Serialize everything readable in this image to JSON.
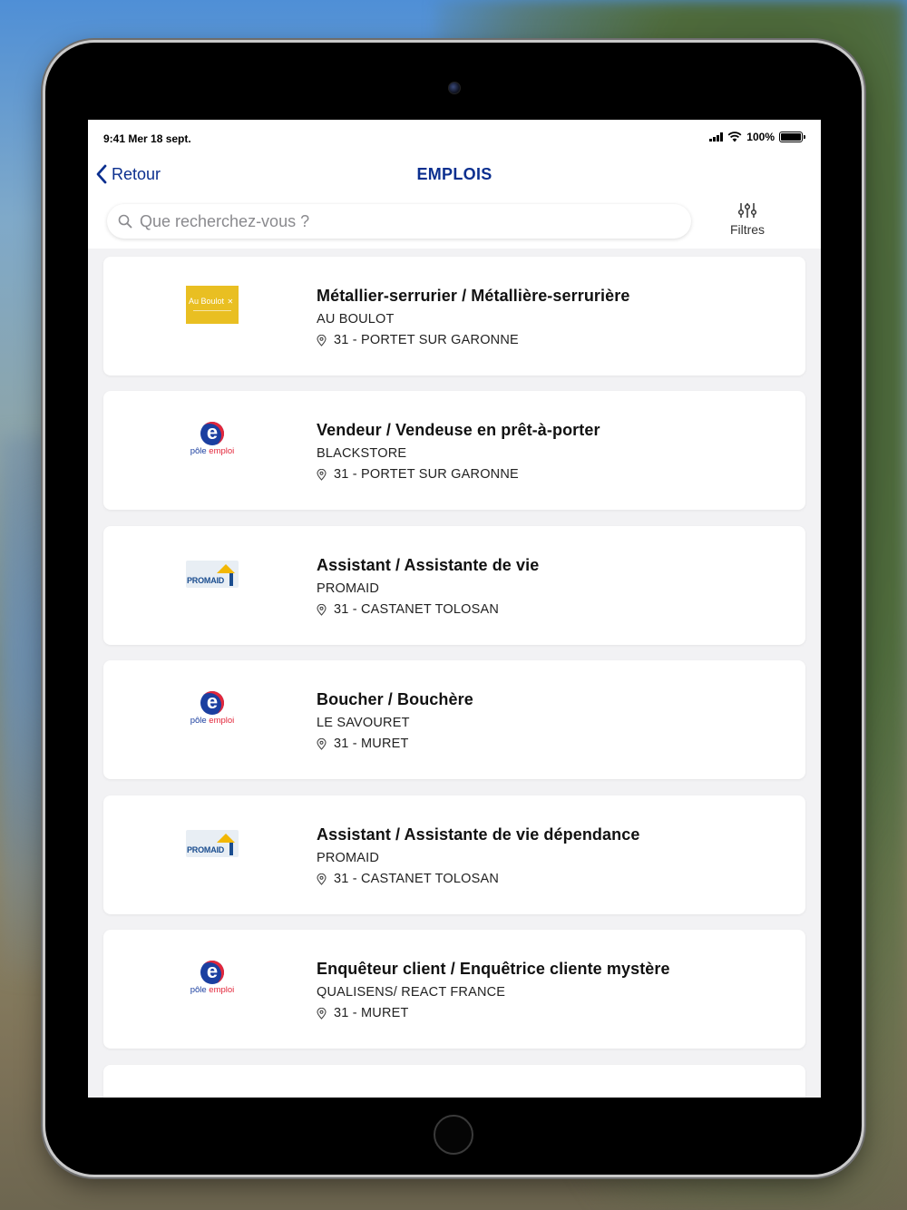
{
  "status_bar": {
    "time_date": "9:41  Mer 18 sept.",
    "battery": "100%"
  },
  "nav": {
    "back_label": "Retour",
    "title": "EMPLOIS"
  },
  "search": {
    "placeholder": "Que recherchez-vous ?",
    "value": ""
  },
  "filters": {
    "label": "Filtres"
  },
  "logo_texts": {
    "au_boulot": "Au Boulot",
    "pole_emploi_e": "e",
    "pole_emploi_a": "pôle",
    "pole_emploi_b": "emploi",
    "promaid": "PROMAID"
  },
  "jobs": [
    {
      "title": "Métallier-serrurier / Métallière-serrurière",
      "company": "AU BOULOT",
      "location": "31 - PORTET SUR GARONNE",
      "logo": "au-boulot"
    },
    {
      "title": "Vendeur / Vendeuse en prêt-à-porter",
      "company": "BLACKSTORE",
      "location": "31 - PORTET SUR GARONNE",
      "logo": "pole-emploi"
    },
    {
      "title": "Assistant / Assistante de vie",
      "company": "PROMAID",
      "location": "31 - CASTANET TOLOSAN",
      "logo": "promaid"
    },
    {
      "title": "Boucher / Bouchère",
      "company": "LE SAVOURET",
      "location": "31 - MURET",
      "logo": "pole-emploi"
    },
    {
      "title": "Assistant / Assistante de vie dépendance",
      "company": "PROMAID",
      "location": "31 - CASTANET TOLOSAN",
      "logo": "promaid"
    },
    {
      "title": "Enquêteur client / Enquêtrice cliente mystère",
      "company": "QUALISENS/ REACT FRANCE",
      "location": "31 - MURET",
      "logo": "pole-emploi"
    }
  ],
  "colors": {
    "accent": "#0b2f8f",
    "screen_background": "#f2f2f4",
    "card_background": "#ffffff"
  }
}
